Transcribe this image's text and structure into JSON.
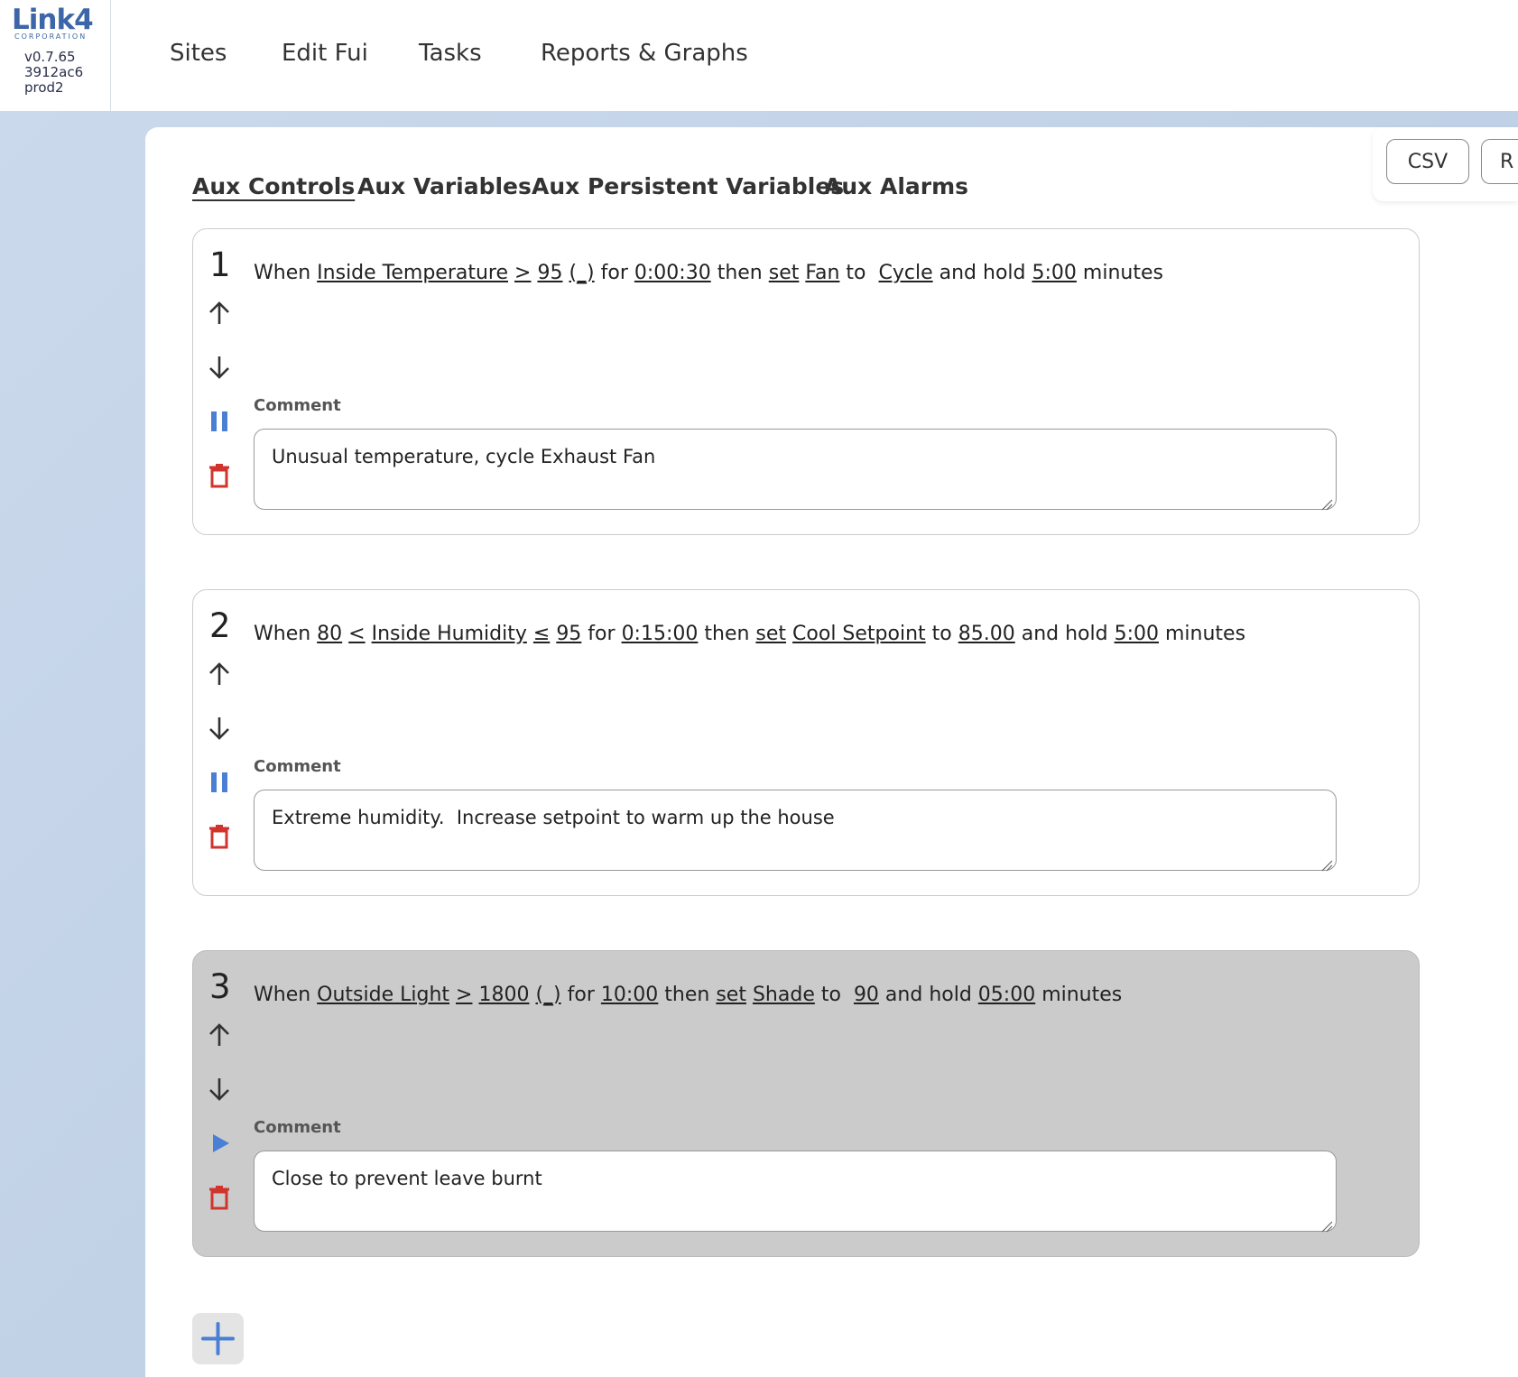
{
  "brand": {
    "logo": "Link4",
    "logo_sub": "CORPORATION",
    "version": "v0.7.65",
    "commit": "3912ac6",
    "env": "prod2"
  },
  "nav": [
    "Sites",
    "Edit Fui",
    "Tasks",
    "Reports & Graphs"
  ],
  "toolbar": {
    "csv": "CSV",
    "second": "R"
  },
  "tabs": [
    "Aux Controls",
    "Aux Variables",
    "Aux Persistent Variables",
    "Aux Alarms"
  ],
  "active_tab": "Aux Controls",
  "comment_label": "Comment",
  "rules": [
    {
      "number": "1",
      "enabled": true,
      "tokens": [
        {
          "t": "When ",
          "u": false
        },
        {
          "t": "Inside Temperature",
          "u": true
        },
        {
          "t": " ",
          "u": false
        },
        {
          "t": ">",
          "u": true
        },
        {
          "t": " ",
          "u": false
        },
        {
          "t": "95",
          "u": true
        },
        {
          "t": " ",
          "u": false
        },
        {
          "t": "(_)",
          "u": true
        },
        {
          "t": " for ",
          "u": false
        },
        {
          "t": "0:00:30",
          "u": true
        },
        {
          "t": " then ",
          "u": false
        },
        {
          "t": "set",
          "u": true
        },
        {
          "t": " ",
          "u": false
        },
        {
          "t": "Fan",
          "u": true
        },
        {
          "t": " to  ",
          "u": false
        },
        {
          "t": "Cycle",
          "u": true
        },
        {
          "t": " and hold ",
          "u": false
        },
        {
          "t": "5:00",
          "u": true
        },
        {
          "t": " minutes",
          "u": false
        }
      ],
      "comment": "Unusual temperature, cycle Exhaust Fan"
    },
    {
      "number": "2",
      "enabled": true,
      "tokens": [
        {
          "t": "When ",
          "u": false
        },
        {
          "t": "80",
          "u": true
        },
        {
          "t": " ",
          "u": false
        },
        {
          "t": "<",
          "u": true
        },
        {
          "t": " ",
          "u": false
        },
        {
          "t": "Inside Humidity",
          "u": true
        },
        {
          "t": " ",
          "u": false
        },
        {
          "t": "≤",
          "u": true
        },
        {
          "t": " ",
          "u": false
        },
        {
          "t": "95",
          "u": true
        },
        {
          "t": " for ",
          "u": false
        },
        {
          "t": "0:15:00",
          "u": true
        },
        {
          "t": " then ",
          "u": false
        },
        {
          "t": "set",
          "u": true
        },
        {
          "t": " ",
          "u": false
        },
        {
          "t": "Cool Setpoint",
          "u": true
        },
        {
          "t": " to ",
          "u": false
        },
        {
          "t": "85.00",
          "u": true
        },
        {
          "t": " and hold ",
          "u": false
        },
        {
          "t": "5:00",
          "u": true
        },
        {
          "t": " minutes",
          "u": false
        }
      ],
      "comment": "Extreme humidity.  Increase setpoint to warm up the house"
    },
    {
      "number": "3",
      "enabled": false,
      "tokens": [
        {
          "t": "When ",
          "u": false
        },
        {
          "t": "Outside Light",
          "u": true
        },
        {
          "t": " ",
          "u": false
        },
        {
          "t": ">",
          "u": true
        },
        {
          "t": " ",
          "u": false
        },
        {
          "t": "1800",
          "u": true
        },
        {
          "t": " ",
          "u": false
        },
        {
          "t": "(_)",
          "u": true
        },
        {
          "t": " for ",
          "u": false
        },
        {
          "t": "10:00",
          "u": true
        },
        {
          "t": " then ",
          "u": false
        },
        {
          "t": "set",
          "u": true
        },
        {
          "t": " ",
          "u": false
        },
        {
          "t": "Shade",
          "u": true
        },
        {
          "t": " to  ",
          "u": false
        },
        {
          "t": "90",
          "u": true
        },
        {
          "t": " and hold ",
          "u": false
        },
        {
          "t": "05:00",
          "u": true
        },
        {
          "t": " minutes",
          "u": false
        }
      ],
      "comment": "Close to prevent leave burnt"
    }
  ],
  "colors": {
    "accent": "#3d66a8",
    "pause_blue": "#4a7fd4",
    "delete_red": "#d0342c",
    "disabled_card": "#cbcbcb"
  }
}
